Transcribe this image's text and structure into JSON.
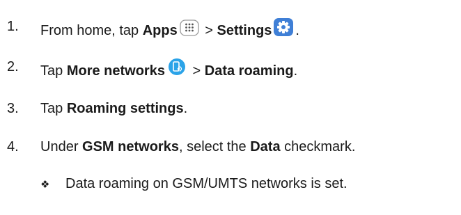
{
  "steps": [
    {
      "number": "1.",
      "parts": {
        "a": "From home, tap ",
        "b": "Apps",
        "c": " > ",
        "d": "Settings",
        "e": "."
      }
    },
    {
      "number": "2.",
      "parts": {
        "a": "Tap ",
        "b": "More networks",
        "c": " > ",
        "d": "Data roaming",
        "e": "."
      }
    },
    {
      "number": "3.",
      "parts": {
        "a": "Tap ",
        "b": "Roaming settings",
        "c": "."
      }
    },
    {
      "number": "4.",
      "parts": {
        "a": "Under ",
        "b": "GSM networks",
        "c": ", select the ",
        "d": "Data",
        "e": " checkmark."
      }
    }
  ],
  "result": {
    "bullet": "❖",
    "text": "Data roaming on GSM/UMTS networks is set."
  },
  "icons": {
    "apps": "apps-icon",
    "settings": "settings-gear-icon",
    "more_networks": "more-networks-icon"
  },
  "colors": {
    "settings_icon": "#3f7fd6",
    "more_networks_icon": "#2ba3e8"
  }
}
